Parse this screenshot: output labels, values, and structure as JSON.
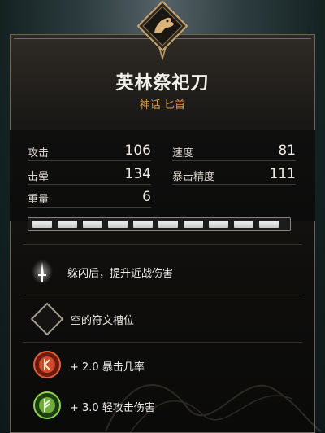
{
  "item": {
    "name": "英林祭祀刀",
    "rarity_type": "神话 匕首"
  },
  "stats": {
    "attack": {
      "label": "攻击",
      "value": "106"
    },
    "stun": {
      "label": "击晕",
      "value": "134"
    },
    "weight": {
      "label": "重量",
      "value": "6"
    },
    "speed": {
      "label": "速度",
      "value": "81"
    },
    "crit_precision": {
      "label": "暴击精度",
      "value": "111"
    }
  },
  "upgrade_levels": {
    "filled": 10,
    "total": 10
  },
  "perk": {
    "icon": "dagger-rune-icon",
    "text": "躲闪后，提升近战伤害"
  },
  "rune_slot": {
    "icon": "empty-diamond-slot-icon",
    "text": "空的符文槽位"
  },
  "bonuses": [
    {
      "icon": "crit-rune-icon",
      "text": "+ 2.0 暴击几率",
      "color": "#d24a2a"
    },
    {
      "icon": "light-attack-rune-icon",
      "text": "+ 3.0 轻攻击伤害",
      "color": "#6fae3c"
    }
  ],
  "colors": {
    "rarity": "#d39a55",
    "panel_border": "#6e6250",
    "emblem_gold": "#c7a46a"
  }
}
